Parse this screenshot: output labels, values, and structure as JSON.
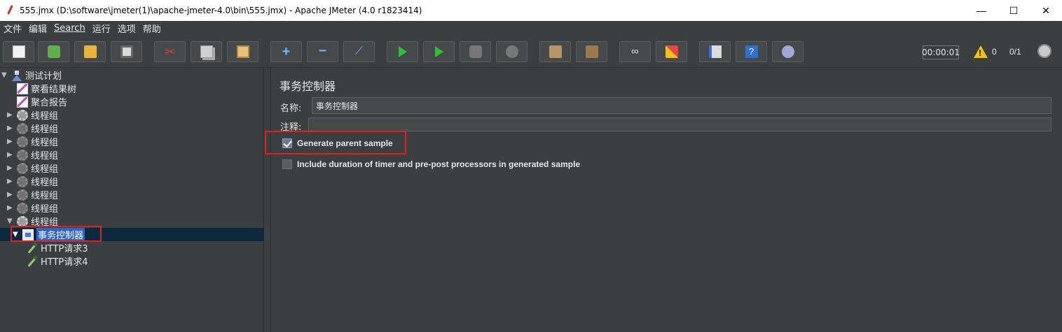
{
  "window": {
    "title": "555.jmx (D:\\software\\jmeter(1)\\apache-jmeter-4.0\\bin\\555.jmx) - Apache JMeter (4.0 r1823414)",
    "minimize": "—",
    "maximize": "☐",
    "close": "✕"
  },
  "menu": [
    "文件",
    "编辑",
    "Search",
    "运行",
    "选项",
    "帮助"
  ],
  "toolbar": {
    "buttons": [
      {
        "name": "new-icon"
      },
      {
        "name": "templates-icon"
      },
      {
        "name": "open-icon"
      },
      {
        "name": "save-icon"
      },
      {
        "name": "cut-icon"
      },
      {
        "name": "copy-icon"
      },
      {
        "name": "paste-icon"
      },
      {
        "name": "expand-icon"
      },
      {
        "name": "collapse-icon"
      },
      {
        "name": "toggle-icon"
      },
      {
        "name": "start-icon"
      },
      {
        "name": "start-no-pause-icon"
      },
      {
        "name": "stop-icon"
      },
      {
        "name": "shutdown-icon"
      },
      {
        "name": "clear-icon"
      },
      {
        "name": "clear-all-icon"
      },
      {
        "name": "search-icon"
      },
      {
        "name": "reset-search-icon"
      },
      {
        "name": "function-helper-icon"
      },
      {
        "name": "help-icon"
      },
      {
        "name": "remote-icon"
      }
    ],
    "timer": "00:00:01",
    "warnings": "0",
    "threads": "0/1"
  },
  "tree": {
    "root": "测试计划",
    "items": [
      {
        "label": "察看结果树",
        "icon": "graph-icon"
      },
      {
        "label": "聚合报告",
        "icon": "graph-icon"
      },
      {
        "label": "线程组",
        "icon": "gear-icon"
      },
      {
        "label": "线程组",
        "icon": "gear-icon"
      },
      {
        "label": "线程组",
        "icon": "gear-icon"
      },
      {
        "label": "线程组",
        "icon": "gear-icon"
      },
      {
        "label": "线程组",
        "icon": "gear-icon"
      },
      {
        "label": "线程组",
        "icon": "gear-icon"
      },
      {
        "label": "线程组",
        "icon": "gear-icon"
      },
      {
        "label": "线程组",
        "icon": "gear-icon"
      },
      {
        "label": "线程组",
        "icon": "gear-icon"
      }
    ],
    "selected": "事务控制器",
    "children": [
      "HTTP请求3",
      "HTTP请求4"
    ]
  },
  "panel": {
    "title": "事务控制器",
    "name_label": "名称:",
    "name_value": "事务控制器",
    "comment_label": "注释:",
    "comment_value": "",
    "checkbox_generate": {
      "label": "Generate parent sample",
      "checked": true
    },
    "checkbox_include": {
      "label": "Include duration of timer and pre-post processors in generated sample",
      "checked": false
    }
  },
  "colors": {
    "highlight_box": "#e02020",
    "selection": "#2f65ca"
  }
}
